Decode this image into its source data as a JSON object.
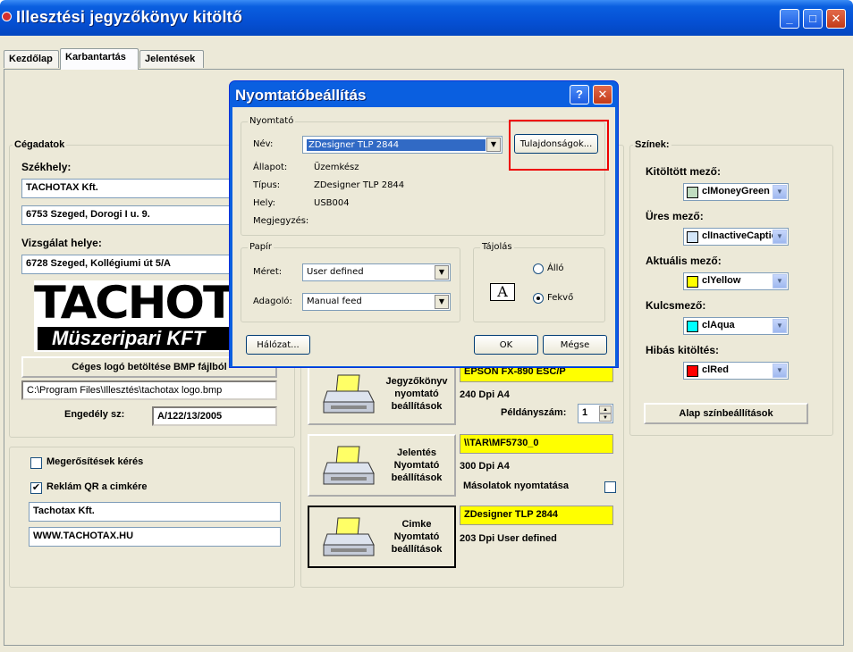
{
  "window": {
    "title": "Illesztési jegyzőkönyv kitöltő",
    "minimize_glyph": "_",
    "maximize_glyph": "□",
    "close_glyph": "✕"
  },
  "tabs": [
    {
      "label": "Kezdőlap"
    },
    {
      "label": "Karbantartás"
    },
    {
      "label": "Jelentések"
    }
  ],
  "company": {
    "group_title": "Cégadatok",
    "seat_label": "Székhely:",
    "name": "TACHOTAX Kft.",
    "address": "6753 Szeged, Dorogi I u. 9.",
    "inspection_label": "Vizsgálat helye:",
    "inspection_address": "6728 Szeged, Kollégiumi út 5/A",
    "logo_main": "TACHOTA",
    "logo_sub": "Müszeripari KFT",
    "load_logo_button": "Céges logó betöltése BMP fájlból",
    "logo_path": "C:\\Program Files\\Illesztés\\tachotax logo.bmp",
    "permit_label": "Engedély sz:",
    "permit_value": "A/122/13/2005"
  },
  "options": {
    "confirm_label": "Megerősítések kérés",
    "confirm_checked": false,
    "qr_label": "Reklám QR a cimkére",
    "qr_checked": true,
    "qr_line1": "Tachotax Kft.",
    "qr_line2": "WWW.TACHOTAX.HU"
  },
  "printers": {
    "record": {
      "button": "Jegyzőkönyv\nnyomtató\nbeállítások",
      "printer_name": "EPSON FX-890 ESC/P",
      "info": "240 Dpi A4",
      "copies_label": "Példányszám:",
      "copies_value": "1"
    },
    "report": {
      "button": "Jelentés\nNyomtató\nbeállítások",
      "printer_name": "\\\\TAR\\MF5730_0",
      "info": "300 Dpi A4",
      "copy_print_label": "Másolatok nyomtatása",
      "copy_print_checked": false
    },
    "label": {
      "button": "Cimke\nNyomtató\nbeállítások",
      "printer_name": "ZDesigner TLP 2844",
      "info": "203 Dpi User defined"
    }
  },
  "colors": {
    "group_title": "Színek:",
    "filled_label": "Kitöltött mező:",
    "filled_value": "clMoneyGreen",
    "filled_color": "#c0dcc0",
    "empty_label": "Üres mező:",
    "empty_value": "clInactiveCaption",
    "empty_color": "#d4e6fa",
    "current_label": "Aktuális mező:",
    "current_value": "clYellow",
    "current_color": "#ffff00",
    "key_label": "Kulcsmező:",
    "key_value": "clAqua",
    "key_color": "#00ffff",
    "error_label": "Hibás kitöltés:",
    "error_value": "clRed",
    "error_color": "#ff0000",
    "reset_button": "Alap színbeállítások"
  },
  "dialog": {
    "title": "Nyomtatóbeállítás",
    "help_glyph": "?",
    "close_glyph": "✕",
    "printer_group": "Nyomtató",
    "name_label": "Név:",
    "name_value": "ZDesigner TLP 2844",
    "properties_button": "Tulajdonságok...",
    "status_label": "Állapot:",
    "status_value": "Üzemkész",
    "type_label": "Típus:",
    "type_value": "ZDesigner TLP 2844",
    "where_label": "Hely:",
    "where_value": "USB004",
    "comment_label": "Megjegyzés:",
    "paper_group": "Papír",
    "size_label": "Méret:",
    "size_value": "User defined",
    "source_label": "Adagoló:",
    "source_value": "Manual feed",
    "orientation_group": "Tájolás",
    "portrait_label": "Álló",
    "landscape_label": "Fekvő",
    "orientation_selected": "landscape",
    "network_button": "Hálózat...",
    "ok_button": "OK",
    "cancel_button": "Mégse"
  }
}
